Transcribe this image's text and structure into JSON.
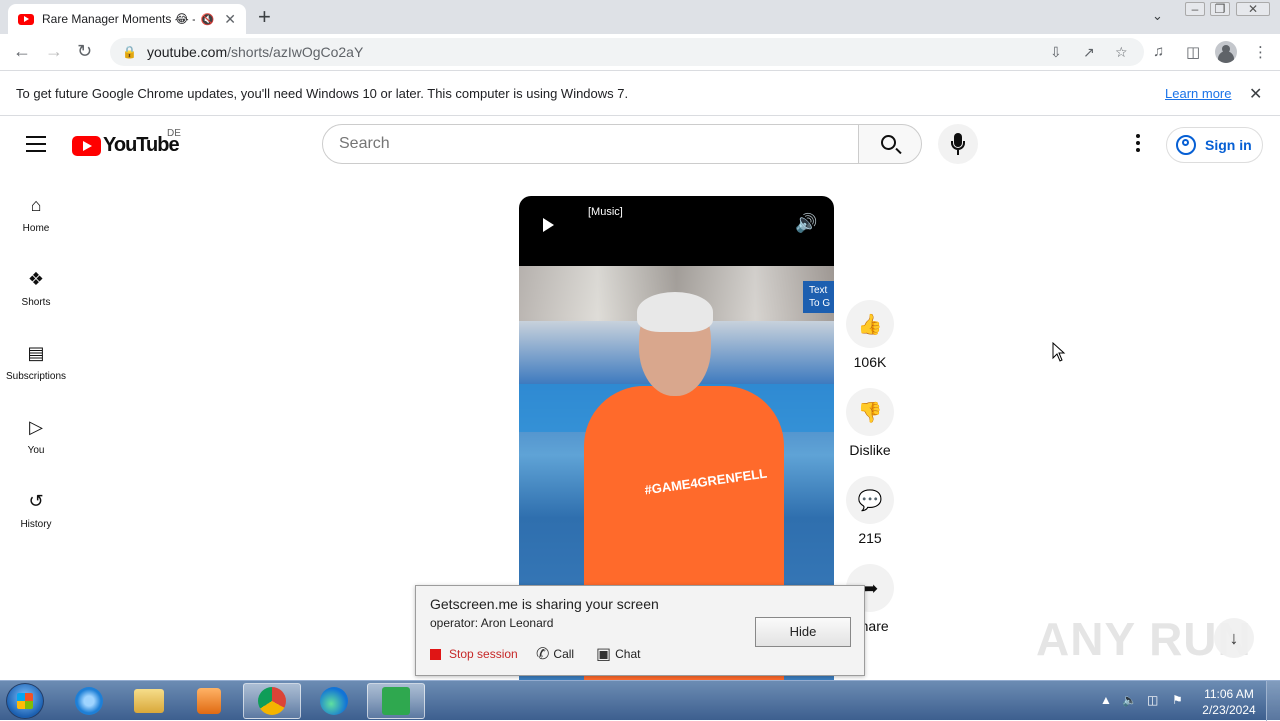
{
  "browser": {
    "tab": {
      "title": "Rare Manager Moments 😂 -",
      "audio_icon": "🔇",
      "close": "✕"
    },
    "new_tab": "+",
    "url_host": "youtube.com",
    "url_path": "/shorts/azIwOgCo2aY"
  },
  "infobar": {
    "message": "To get future Google Chrome updates, you'll need Windows 10 or later. This computer is using Windows 7.",
    "learn_more": "Learn more",
    "close": "✕"
  },
  "youtube": {
    "logo_text": "YouTube",
    "country_code": "DE",
    "search_placeholder": "Search",
    "sign_in": "Sign in",
    "guide": [
      {
        "label": "Home",
        "icon": "home-icon"
      },
      {
        "label": "Shorts",
        "icon": "shorts-icon"
      },
      {
        "label": "Subscriptions",
        "icon": "subscriptions-icon"
      },
      {
        "label": "You",
        "icon": "you-icon"
      },
      {
        "label": "History",
        "icon": "history-icon"
      }
    ],
    "player": {
      "caption": "[Music]",
      "shirt_text": "#GAME4GRENFELL",
      "chip_text_1": "Text",
      "chip_text_2": "To G"
    },
    "actions": {
      "like_count": "106K",
      "dislike_label": "Dislike",
      "comment_count": "215",
      "share_label": "Share"
    }
  },
  "getscreen": {
    "title": "Getscreen.me is sharing your screen",
    "operator": "operator: Aron Leonard",
    "hide": "Hide",
    "stop": "Stop session",
    "call": "Call",
    "chat": "Chat"
  },
  "watermark": "ANY RUN",
  "taskbar": {
    "time": "11:06 AM",
    "date": "2/23/2024"
  }
}
